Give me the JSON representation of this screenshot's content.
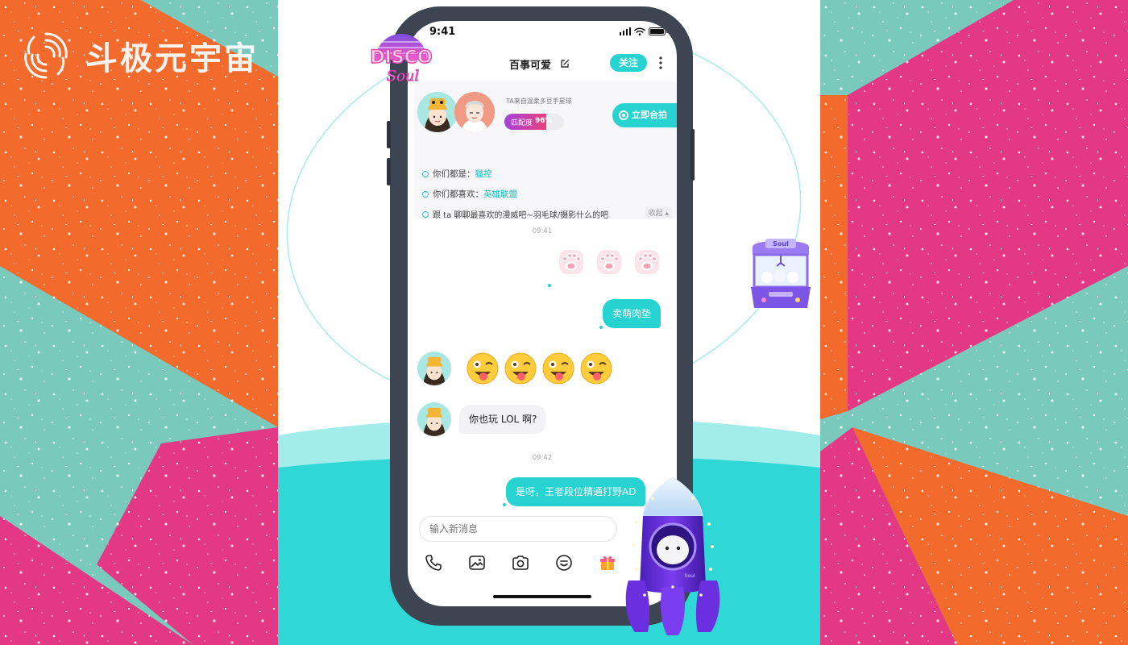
{
  "brand": {
    "name": "斗极元宇宙"
  },
  "colors": {
    "accent": "#27d3d0",
    "orange": "#f26a2c",
    "pink": "#e33985",
    "teal": "#79c9bd",
    "phone_frame": "#3d4452"
  },
  "stickers": {
    "disco_line1": "DISCO",
    "disco_line2": "Soul",
    "claw_machine_label": "Soul",
    "rocket_label": "Soul"
  },
  "status_bar": {
    "time": "9:41"
  },
  "chat_header": {
    "title": "百事可爱",
    "follow_label": "关注",
    "edit_icon": "edit-icon",
    "more_icon": "more-icon"
  },
  "match_card": {
    "hint": "TA来自温柔多豆手星球",
    "badge_label": "匹配度",
    "badge_value": "96%",
    "shoot_label": "立即合拍",
    "lines": [
      {
        "prefix": "你们都是：",
        "highlight": "猫控",
        "suffix": ""
      },
      {
        "prefix": "你们都喜欢：",
        "highlight": "英雄联盟",
        "suffix": ""
      },
      {
        "prefix": "跟 ta 聊聊最喜欢的漫威吧~羽毛球/摄影什么的吧",
        "highlight": "",
        "suffix": ""
      }
    ],
    "collapse_label": "收起 ▴"
  },
  "messages": {
    "timestamp_1": "09:41",
    "sent_1": "卖萌肉垫",
    "received_1": "你也玩 LOL 啊?",
    "timestamp_2": "09:42",
    "sent_2": "是呀，王者段位精通打野AD"
  },
  "input": {
    "placeholder": "输入新消息"
  },
  "toolbar": {
    "icons": [
      "phone-icon",
      "image-icon",
      "camera-icon",
      "emoji-icon",
      "gift-icon"
    ]
  }
}
